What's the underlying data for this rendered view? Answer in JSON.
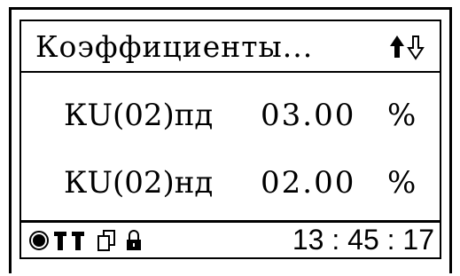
{
  "screen": {
    "title": "Коэффициенты...",
    "nav": {
      "up_icon": "arrow-up-filled-icon",
      "down_icon": "arrow-down-outline-icon"
    },
    "rows": [
      {
        "param": "КU(02)пд",
        "value": "03.00",
        "unit": "%"
      },
      {
        "param": "КU(02)нд",
        "value": "02.00",
        "unit": "%"
      }
    ],
    "status": {
      "icons": [
        "record-icon",
        "antenna-icon",
        "antenna-icon",
        "copy-icon",
        "lock-icon"
      ],
      "time": "13 : 45 : 17"
    }
  }
}
